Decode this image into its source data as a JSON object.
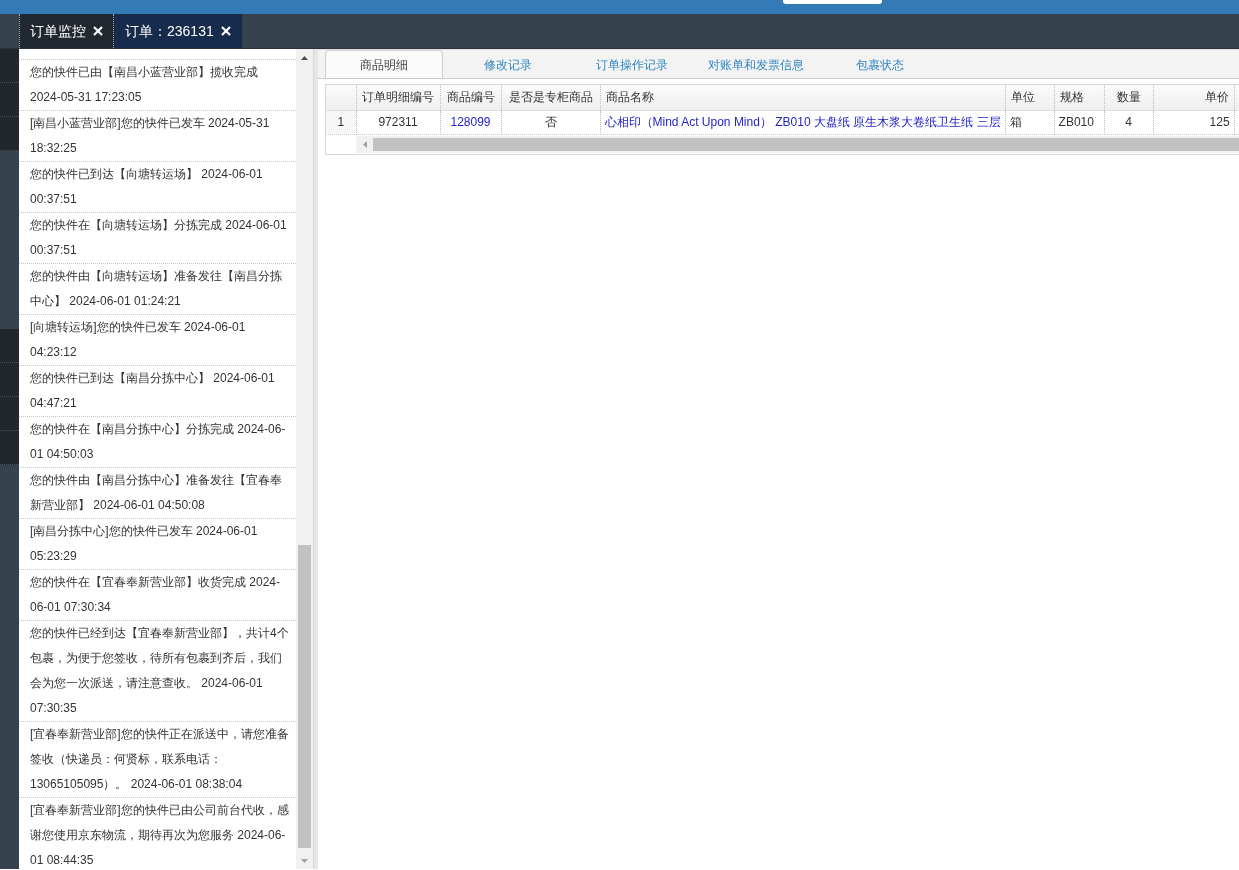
{
  "tabs": [
    {
      "label": "订单监控",
      "selected": false
    },
    {
      "label": "订单：236131",
      "selected": true
    }
  ],
  "tracking_events": [
    "您的快件已由【南昌小蓝营业部】揽收完成 2024-05-31 17:23:05",
    "[南昌小蓝营业部]您的快件已发车 2024-05-31 18:32:25",
    "您的快件已到达【向塘转运场】 2024-06-01 00:37:51",
    "您的快件在【向塘转运场】分拣完成 2024-06-01 00:37:51",
    "您的快件由【向塘转运场】准备发往【南昌分拣中心】 2024-06-01 01:24:21",
    "[向塘转运场]您的快件已发车 2024-06-01 04:23:12",
    "您的快件已到达【南昌分拣中心】 2024-06-01 04:47:21",
    "您的快件在【南昌分拣中心】分拣完成 2024-06-01 04:50:03",
    "您的快件由【南昌分拣中心】准备发往【宜春奉新营业部】 2024-06-01 04:50:08",
    "[南昌分拣中心]您的快件已发车 2024-06-01 05:23:29",
    "您的快件在【宜春奉新营业部】收货完成 2024-06-01 07:30:34",
    "您的快件已经到达【宜春奉新营业部】，共计4个包裹，为便于您签收，待所有包裹到齐后，我们会为您一次派送，请注意查收。 2024-06-01 07:30:35",
    "[宜春奉新营业部]您的快件正在派送中，请您准备签收（快递员：何贤标，联系电话：13065105095）。 2024-06-01 08:38:04",
    "[宜春奉新营业部]您的快件已由公司前台代收，感谢您使用京东物流，期待再次为您服务 2024-06-01 08:44:35"
  ],
  "detail_tabs": [
    {
      "label": "商品明细",
      "selected": true
    },
    {
      "label": "修改记录",
      "selected": false
    },
    {
      "label": "订单操作记录",
      "selected": false
    },
    {
      "label": "对账单和发票信息",
      "selected": false
    },
    {
      "label": "包裹状态",
      "selected": false
    }
  ],
  "table": {
    "columns": [
      {
        "kind": "rownum"
      },
      {
        "label": "订单明细编号",
        "kind": "center"
      },
      {
        "label": "商品编号",
        "kind": "link"
      },
      {
        "label": "是否是专柜商品",
        "kind": "center"
      },
      {
        "label": "商品名称",
        "kind": "title"
      },
      {
        "label": "单位",
        "kind": "left"
      },
      {
        "label": "规格",
        "kind": "left"
      },
      {
        "label": "数量",
        "kind": "center"
      },
      {
        "label": "单价",
        "kind": "right"
      }
    ],
    "rows": [
      {
        "cells": [
          "1",
          "972311",
          "128099",
          "否",
          "心相印（Mind Act Upon Mind） ZB010 大盘纸 原生木浆大卷纸卫生纸 三层",
          "箱",
          "ZB010",
          "4",
          "125"
        ]
      }
    ]
  }
}
